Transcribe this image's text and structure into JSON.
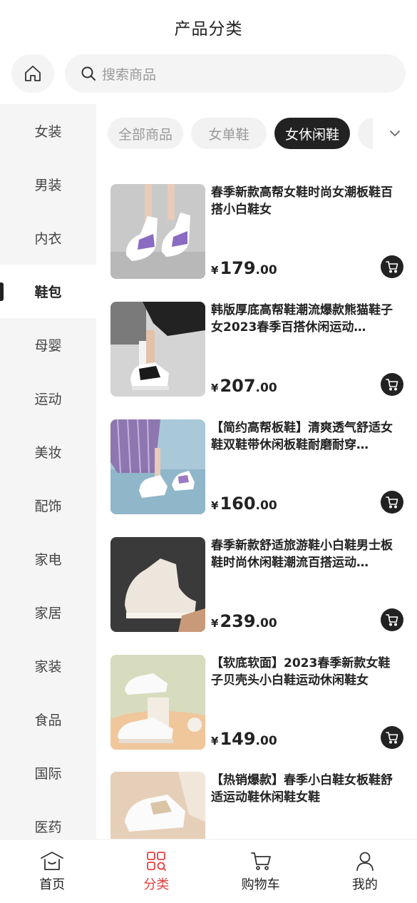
{
  "header": {
    "title": "产品分类"
  },
  "search": {
    "placeholder": "搜索商品"
  },
  "sidebar": {
    "items": [
      {
        "label": "女装",
        "active": false
      },
      {
        "label": "男装",
        "active": false
      },
      {
        "label": "内衣",
        "active": false
      },
      {
        "label": "鞋包",
        "active": true
      },
      {
        "label": "母婴",
        "active": false
      },
      {
        "label": "运动",
        "active": false
      },
      {
        "label": "美妆",
        "active": false
      },
      {
        "label": "配饰",
        "active": false
      },
      {
        "label": "家电",
        "active": false
      },
      {
        "label": "家居",
        "active": false
      },
      {
        "label": "家装",
        "active": false
      },
      {
        "label": "食品",
        "active": false
      },
      {
        "label": "国际",
        "active": false
      },
      {
        "label": "医药",
        "active": false
      }
    ]
  },
  "tabs": [
    {
      "label": "全部商品",
      "active": false
    },
    {
      "label": "女单鞋",
      "active": false
    },
    {
      "label": "女休闲鞋",
      "active": true
    }
  ],
  "products": [
    {
      "name": "春季新款高帮女鞋时尚女潮板鞋百搭小白鞋女",
      "currency": "¥",
      "price_int": "179",
      "price_dec": ".00"
    },
    {
      "name": "韩版厚底高帮鞋潮流爆款熊猫鞋子女2023春季百搭休闲运动…",
      "currency": "¥",
      "price_int": "207",
      "price_dec": ".00"
    },
    {
      "name": "【简约高帮板鞋】清爽透气舒适女鞋双鞋带休闲板鞋耐磨耐穿…",
      "currency": "¥",
      "price_int": "160",
      "price_dec": ".00"
    },
    {
      "name": "春季新款舒适旅游鞋小白鞋男士板鞋时尚休闲鞋潮流百搭运动…",
      "currency": "¥",
      "price_int": "239",
      "price_dec": ".00"
    },
    {
      "name": "【软底软面】2023春季新款女鞋子贝壳头小白鞋运动休闲鞋女",
      "currency": "¥",
      "price_int": "149",
      "price_dec": ".00"
    },
    {
      "name": "【热销爆款】春季小白鞋女板鞋舒适运动鞋休闲鞋女鞋",
      "currency": "¥",
      "price_int": "",
      "price_dec": ""
    }
  ],
  "tabbar": [
    {
      "label": "首页",
      "icon": "home-icon",
      "active": false
    },
    {
      "label": "分类",
      "icon": "category-icon",
      "active": true
    },
    {
      "label": "购物车",
      "icon": "cart-icon",
      "active": false
    },
    {
      "label": "我的",
      "icon": "user-icon",
      "active": false
    }
  ],
  "colors": {
    "accent": "#e0403f",
    "dark": "#222222",
    "sidebar_bg": "#f5f5f5",
    "chip_bg": "#f2f2f2"
  }
}
